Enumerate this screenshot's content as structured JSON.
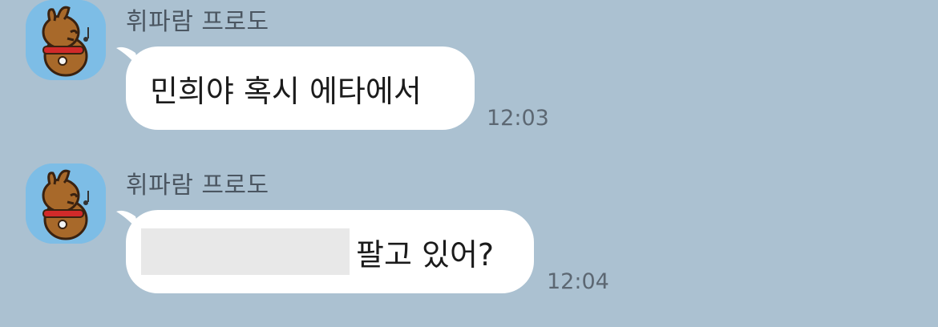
{
  "chat": {
    "messages": [
      {
        "sender": "휘파람 프로도",
        "text": "민희야 혹시 에타에서",
        "time": "12:03",
        "avatar": "frodo-character-avatar"
      },
      {
        "sender": "휘파람 프로도",
        "text": "팔고 있어?",
        "time": "12:04",
        "avatar": "frodo-character-avatar",
        "redacted_prefix": true
      }
    ]
  },
  "colors": {
    "background": "#abc1d1",
    "bubble": "#ffffff",
    "avatar_bg": "#7dbde6",
    "redaction": "#e8e8e8"
  }
}
